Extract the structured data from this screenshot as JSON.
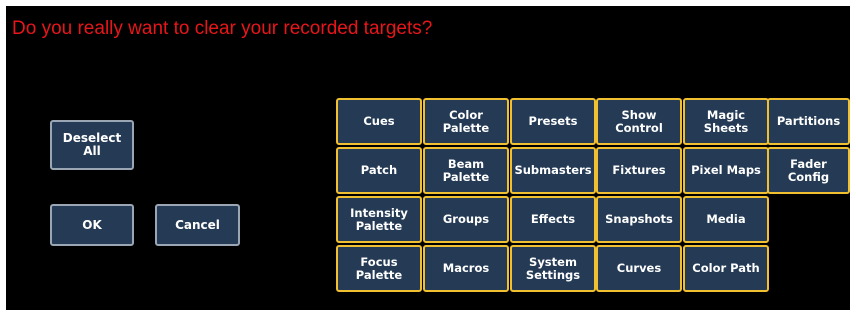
{
  "prompt": "Do you really want to clear your recorded targets?",
  "buttons": {
    "deselect_all": "Deselect\nAll",
    "ok": "OK",
    "cancel": "Cancel"
  },
  "targets": [
    [
      "Cues",
      "Color\nPalette",
      "Presets",
      "Show\nControl",
      "Magic\nSheets",
      "Partitions"
    ],
    [
      "Patch",
      "Beam\nPalette",
      "Submasters",
      "Fixtures",
      "Pixel Maps",
      "Fader Config"
    ],
    [
      "Intensity\nPalette",
      "Groups",
      "Effects",
      "Snapshots",
      "Media"
    ],
    [
      "Focus\nPalette",
      "Macros",
      "System\nSettings",
      "Curves",
      "Color Path"
    ]
  ],
  "colors": {
    "prompt": "#e8161a",
    "button_fill": "#243a55",
    "target_border": "#f0c030",
    "dialog_button_border": "#9aa6b4"
  }
}
